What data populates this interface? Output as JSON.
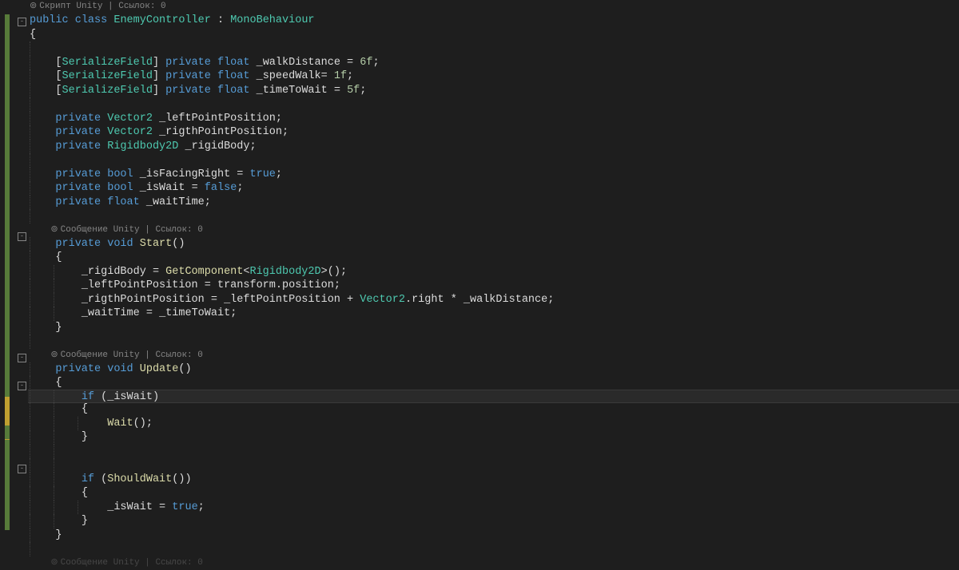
{
  "codelens": {
    "unityScript": "Скрипт Unity | Ссылок: 0",
    "unityMessage": "Сообщение Unity | Ссылок: 0",
    "unityMessage2": "Сообщение Unity | Ссылок: 0",
    "bottom": "Сообщение Unity | Ссылок: 0"
  },
  "tokens": {
    "public": "public",
    "class": "class",
    "className": "EnemyController",
    "colon": ":",
    "baseClass": "MonoBehaviour",
    "lbrace": "{",
    "rbrace": "}",
    "SerializeField": "SerializeField",
    "private": "private",
    "float": "float",
    "bool": "bool",
    "void": "void",
    "true": "true",
    "false": "false",
    "if": "if",
    "walkDistance": "_walkDistance",
    "val6f": "6f",
    "speedWalk": "_speedWalk",
    "val1f": "1f",
    "timeToWait": "_timeToWait",
    "val5f": "5f",
    "Vector2": "Vector2",
    "leftPointPosition": "_leftPointPosition",
    "rigthPointPosition": "_rigthPointPosition",
    "Rigidbody2D": "Rigidbody2D",
    "rigidBody": "_rigidBody",
    "isFacingRight": "_isFacingRight",
    "isWait": "_isWait",
    "waitTime": "_waitTime",
    "Start": "Start",
    "Update": "Update",
    "GetComponent": "GetComponent",
    "transform": "transform",
    "position": "position",
    "right": "right",
    "Wait": "Wait",
    "ShouldWait": "ShouldWait",
    "eq": "=",
    "eq2": "=",
    "star": "*",
    "plus": "+",
    "semi": ";",
    "lpar": "(",
    "rpar": ")",
    "lbrk": "[",
    "rbrk": "]",
    "lt": "<",
    "gt": ">",
    "dot": "."
  }
}
